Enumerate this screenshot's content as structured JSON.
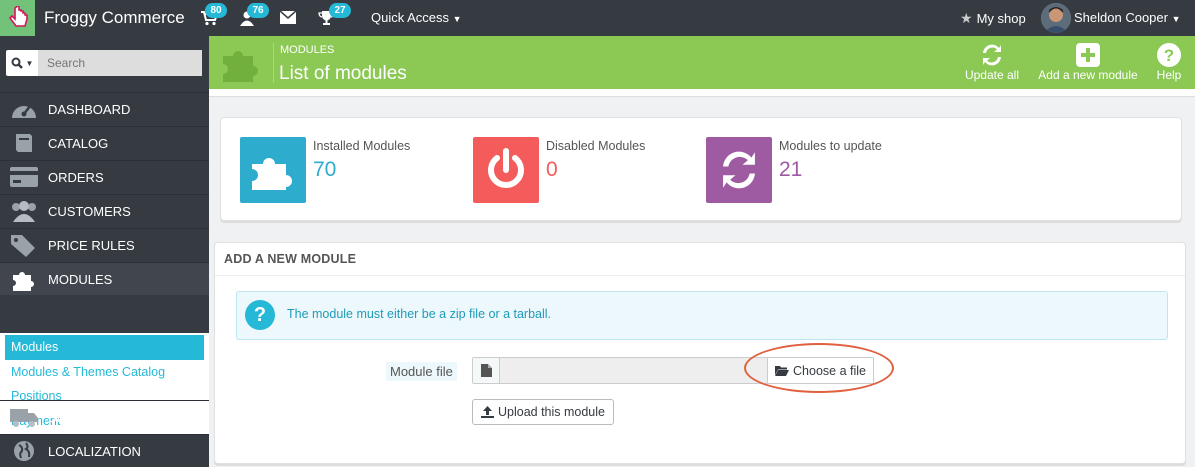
{
  "topbar": {
    "brand": "Froggy Commerce",
    "badges": {
      "orders": "80",
      "customers": "76",
      "messages": "",
      "achievements": "27"
    },
    "quick_access": "Quick Access",
    "my_shop": "My shop",
    "user_name": "Sheldon Cooper"
  },
  "sidebar": {
    "search_placeholder": "Search",
    "items": [
      {
        "label": "DASHBOARD",
        "icon": "dashboard-icon"
      },
      {
        "label": "CATALOG",
        "icon": "book-icon"
      },
      {
        "label": "ORDERS",
        "icon": "credit-card-icon"
      },
      {
        "label": "CUSTOMERS",
        "icon": "users-icon"
      },
      {
        "label": "PRICE RULES",
        "icon": "tags-icon"
      },
      {
        "label": "MODULES",
        "icon": "puzzle-icon"
      },
      {
        "label": "SHIPPING",
        "icon": "truck-icon"
      },
      {
        "label": "LOCALIZATION",
        "icon": "globe-icon"
      }
    ],
    "submenu": [
      "Modules",
      "Modules & Themes Catalog",
      "Positions",
      "Payment"
    ]
  },
  "header": {
    "breadcrumb": "MODULES",
    "title": "List of modules",
    "actions": [
      "Update all",
      "Add a new module",
      "Help"
    ]
  },
  "kpis": [
    {
      "title": "Installed Modules",
      "value": "70",
      "color": "#2eacce"
    },
    {
      "title": "Disabled Modules",
      "value": "0",
      "color": "#f45b5b"
    },
    {
      "title": "Modules to update",
      "value": "21",
      "color": "#9e5ba1"
    }
  ],
  "add_module": {
    "heading": "ADD A NEW MODULE",
    "alert": "The module must either be a zip file or a tarball.",
    "file_label": "Module file",
    "choose_label": "Choose a file",
    "upload_label": "Upload this module"
  },
  "colors": {
    "accent": "#25b9d7",
    "header_green": "#8bc954",
    "dark": "#363a41",
    "highlight": "#e0603f"
  }
}
